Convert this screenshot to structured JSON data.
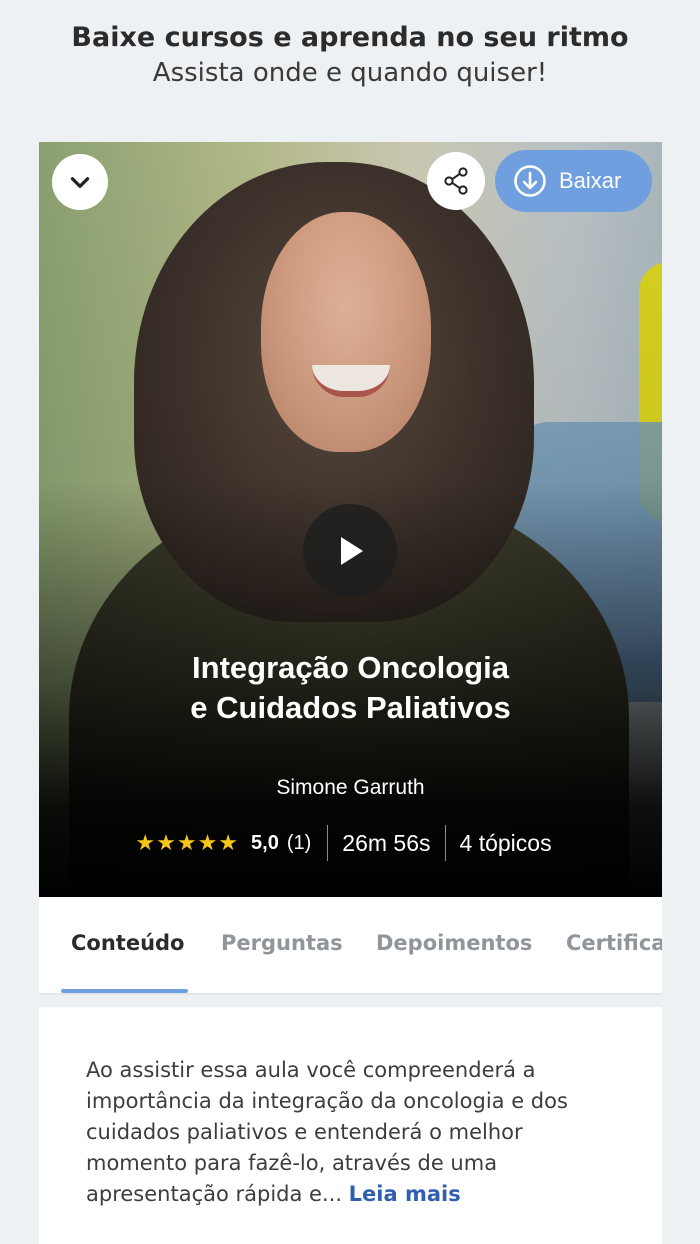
{
  "promo": {
    "title": "Baixe cursos e aprenda no seu ritmo",
    "subtitle": "Assista onde e quando quiser!"
  },
  "hero": {
    "download_label": "Baixar",
    "course_title_line1": "Integração Oncologia",
    "course_title_line2": "e Cuidados Paliativos",
    "instructor": "Simone Garruth",
    "stars": "★★★★★",
    "rating_value": "5,0",
    "rating_count": "(1)",
    "duration": "26m 56s",
    "topics": "4 tópicos"
  },
  "tabs": [
    {
      "label": "Conteúdo",
      "active": true
    },
    {
      "label": "Perguntas",
      "active": false
    },
    {
      "label": "Depoimentos",
      "active": false
    },
    {
      "label": "Certificado",
      "active": false
    }
  ],
  "content": {
    "description": "Ao assistir essa aula você compreenderá a importância da integração da oncologia e dos cuidados paliativos e entenderá o melhor momento para fazê-lo, através de uma apresentação rápida e... ",
    "read_more": "Leia mais"
  },
  "colors": {
    "accent": "#6f9fde",
    "link": "#2f5fae",
    "stars": "#f5c518"
  }
}
